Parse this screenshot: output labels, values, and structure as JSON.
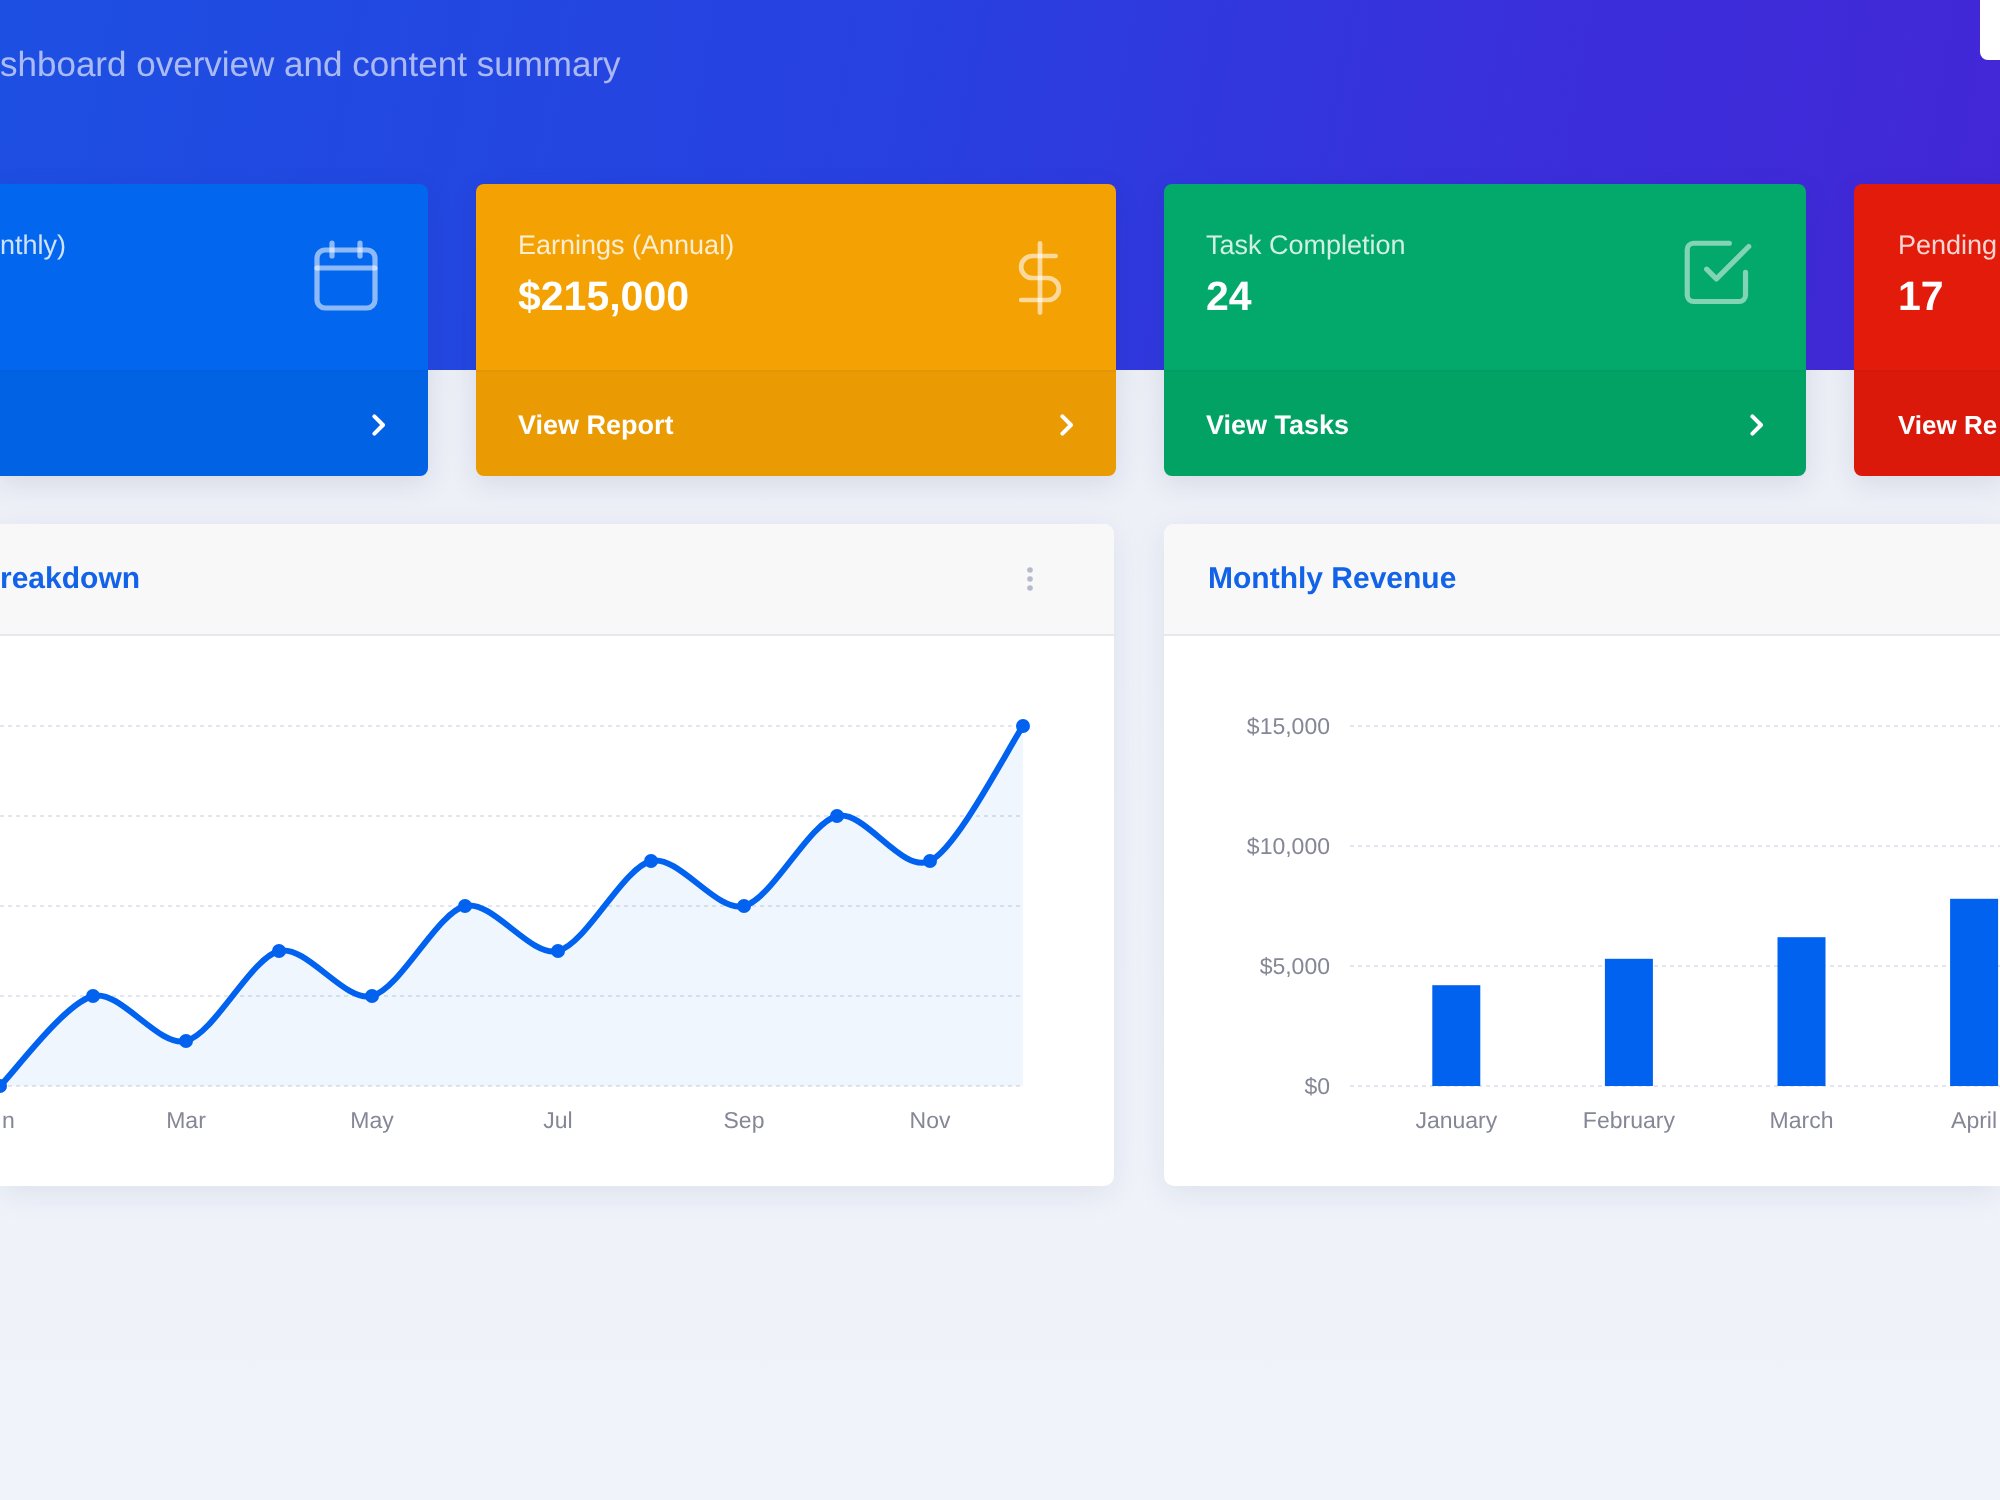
{
  "header": {
    "subtitle": "shboard overview and content summary"
  },
  "stat_cards": [
    {
      "label": "nthly)",
      "color": "#0366ee"
    },
    {
      "label": "Earnings (Annual)",
      "value": "$215,000",
      "link": "View Report",
      "color": "#f4a104"
    },
    {
      "label": "Task Completion",
      "value": "24",
      "link": "View Tasks",
      "color": "#03a96a"
    },
    {
      "label": "Pending",
      "value": "17",
      "link": "View Re",
      "color": "#e31b0b"
    }
  ],
  "charts": [
    {
      "title": "reakdown",
      "menu": true,
      "x_labels": [
        "n",
        "Mar",
        "May",
        "Jul",
        "Sep",
        "Nov"
      ]
    },
    {
      "title": "Monthly Revenue",
      "chart_data": {
        "type": "bar",
        "categories": [
          "January",
          "February",
          "March",
          "April"
        ],
        "values": [
          4200,
          5300,
          6200,
          7800
        ],
        "color": "#0062ee",
        "ylim": [
          0,
          15000
        ],
        "yticks": [
          {
            "value": 0,
            "label": "$0"
          },
          {
            "value": 5000,
            "label": "$5,000"
          },
          {
            "value": 10000,
            "label": "$10,000"
          },
          {
            "value": 15000,
            "label": "$15,000"
          }
        ],
        "grid": true
      }
    }
  ]
}
